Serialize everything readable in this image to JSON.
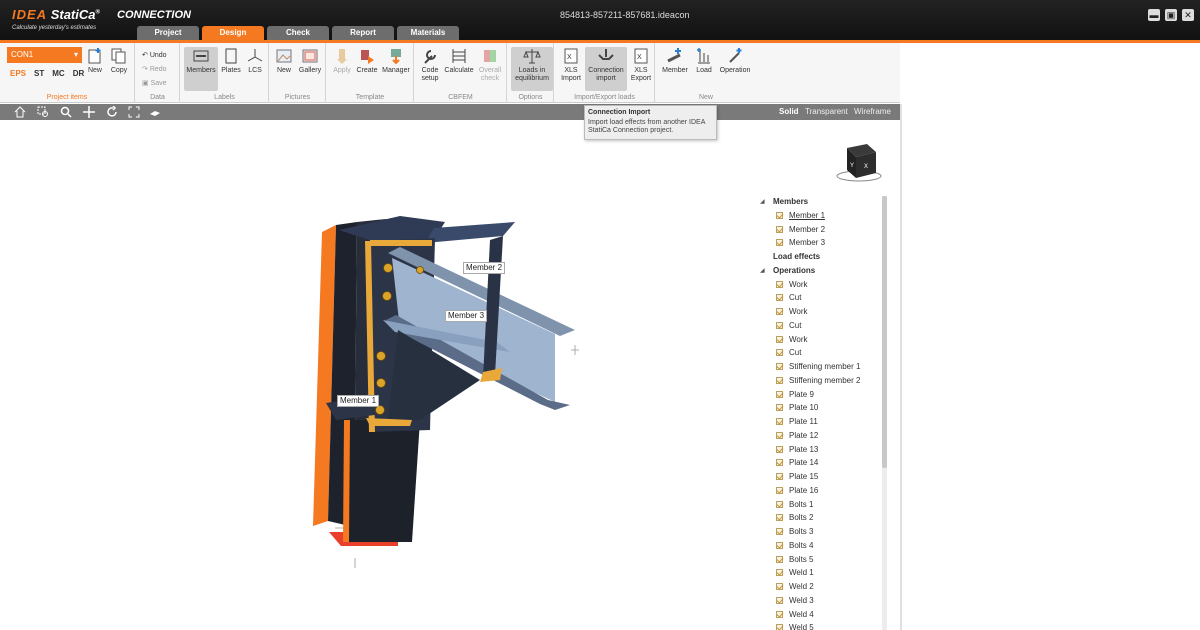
{
  "app": {
    "logo_brand": "IDEA",
    "logo_name": "StatiCa",
    "logo_reg": "®",
    "tagline": "Calculate yesterday's estimates",
    "product": "CONNECTION",
    "filename": "854813-857211-857681.ideacon"
  },
  "window_controls": {
    "minimize": "▬",
    "maximize": "▣",
    "close": "✕"
  },
  "tabs": [
    {
      "label": "Project",
      "active": false
    },
    {
      "label": "Design",
      "active": true
    },
    {
      "label": "Check",
      "active": false
    },
    {
      "label": "Report",
      "active": false
    },
    {
      "label": "Materials",
      "active": false
    }
  ],
  "ribbon": {
    "project_items": {
      "connection_select": "CON1",
      "modes": [
        "EPS",
        "ST",
        "MC",
        "DR"
      ],
      "new": "New",
      "copy": "Copy",
      "group": "Project items"
    },
    "data": {
      "undo": "Undo",
      "redo": "Redo",
      "save": "Save",
      "group": "Data"
    },
    "labels": {
      "members": "Members",
      "plates": "Plates",
      "lcs": "LCS",
      "group": "Labels"
    },
    "pictures": {
      "new": "New",
      "gallery": "Gallery",
      "group": "Pictures"
    },
    "template": {
      "apply": "Apply",
      "create": "Create",
      "manager": "Manager",
      "group": "Template"
    },
    "cbfem": {
      "code_setup_1": "Code",
      "code_setup_2": "setup",
      "calculate": "Calculate",
      "overall_1": "Overall",
      "overall_2": "check",
      "group": "CBFEM"
    },
    "options": {
      "loads_1": "Loads in",
      "loads_2": "equilibrium",
      "group": "Options"
    },
    "import_export": {
      "xls_import_1": "XLS",
      "xls_import_2": "Import",
      "conn_import_1": "Connection",
      "conn_import_2": "import",
      "xls_export_1": "XLS",
      "xls_export_2": "Export",
      "group": "Import/Export loads"
    },
    "new_group": {
      "member": "Member",
      "load": "Load",
      "operation": "Operation",
      "group": "New"
    }
  },
  "viewport_toolbar": {
    "solid": "Solid",
    "transparent": "Transparent",
    "wireframe": "Wireframe"
  },
  "tooltip": {
    "title": "Connection Import",
    "line1": "Import load effects from another IDEA",
    "line2": "StatiCa Connection project."
  },
  "members_3d": {
    "m1": "Member 1",
    "m2": "Member 2",
    "m3": "Member 3"
  },
  "tree": {
    "members_header": "Members",
    "members": [
      "Member 1",
      "Member 2",
      "Member 3"
    ],
    "load_effects": "Load effects",
    "operations_header": "Operations",
    "operations": [
      "Work",
      "Cut",
      "Work",
      "Cut",
      "Work",
      "Cut",
      "Stiffening member 1",
      "Stiffening member 2",
      "Plate 9",
      "Plate 10",
      "Plate 11",
      "Plate 12",
      "Plate 13",
      "Plate 14",
      "Plate 15",
      "Plate 16",
      "Bolts 1",
      "Bolts 2",
      "Bolts 3",
      "Bolts 4",
      "Bolts 5",
      "Weld 1",
      "Weld 2",
      "Weld 3",
      "Weld 4",
      "Weld 5"
    ]
  },
  "colors": {
    "accent": "#f47920",
    "steel": "#2b3345",
    "beam": "#9fb4cf",
    "weld": "#e8a93a"
  }
}
